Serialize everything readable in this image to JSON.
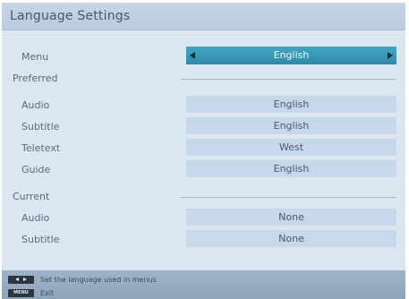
{
  "window": {
    "title": "Language Settings"
  },
  "menu_row": {
    "label": "Menu",
    "value": "English"
  },
  "preferred": {
    "heading": "Preferred",
    "rows": [
      {
        "label": "Audio",
        "value": "English"
      },
      {
        "label": "Subtitle",
        "value": "English"
      },
      {
        "label": "Teletext",
        "value": "West"
      },
      {
        "label": "Guide",
        "value": "English"
      }
    ]
  },
  "current": {
    "heading": "Current",
    "rows": [
      {
        "label": "Audio",
        "value": "None"
      },
      {
        "label": "Subtitle",
        "value": "None"
      }
    ]
  },
  "footer": {
    "hint_navigate": "Set the language used in menus",
    "menu_key_label": "MENU",
    "hint_exit": "Exit"
  },
  "colors": {
    "background": "#dbe6f1",
    "selected_row": "#3a9bb8",
    "value_box": "#c6d8ea",
    "footer": "#97acc2"
  }
}
